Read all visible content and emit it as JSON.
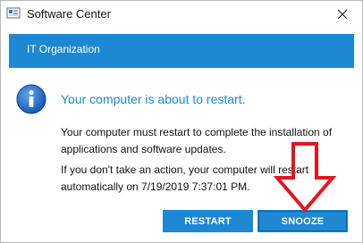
{
  "window": {
    "title": "Software Center"
  },
  "banner": {
    "text": "IT Organization"
  },
  "message": {
    "headline": "Your computer is about to restart.",
    "paragraph1": "Your computer must restart to complete the installation of applications and software updates.",
    "paragraph2": "If you don't take an action, your computer will restart automatically on 7/19/2019 7:37:01 PM."
  },
  "buttons": {
    "restart": "RESTART",
    "snooze": "SNOOZE"
  },
  "colors": {
    "accent": "#1e88d3",
    "annotation_arrow": "#e5151d"
  },
  "icons": {
    "app": "software-center-icon",
    "close": "close-icon",
    "info": "info-icon",
    "annotation": "arrow-down-annotation-icon"
  }
}
